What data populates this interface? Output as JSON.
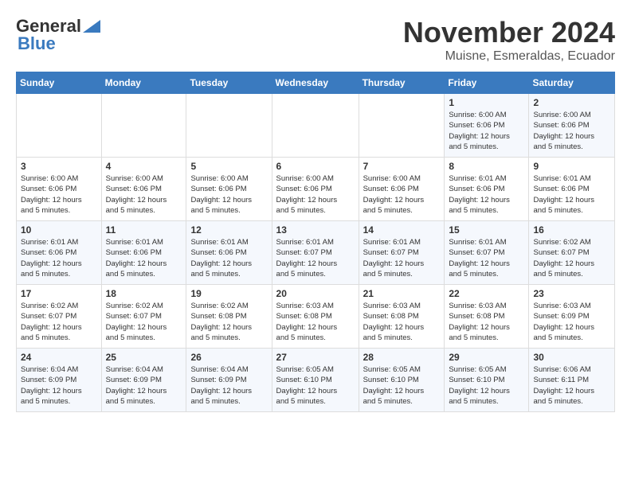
{
  "header": {
    "logo_general": "General",
    "logo_blue": "Blue",
    "title": "November 2024",
    "subtitle": "Muisne, Esmeraldas, Ecuador"
  },
  "days_of_week": [
    "Sunday",
    "Monday",
    "Tuesday",
    "Wednesday",
    "Thursday",
    "Friday",
    "Saturday"
  ],
  "weeks": [
    [
      {
        "day": "",
        "info": ""
      },
      {
        "day": "",
        "info": ""
      },
      {
        "day": "",
        "info": ""
      },
      {
        "day": "",
        "info": ""
      },
      {
        "day": "",
        "info": ""
      },
      {
        "day": "1",
        "info": "Sunrise: 6:00 AM\nSunset: 6:06 PM\nDaylight: 12 hours\nand 5 minutes."
      },
      {
        "day": "2",
        "info": "Sunrise: 6:00 AM\nSunset: 6:06 PM\nDaylight: 12 hours\nand 5 minutes."
      }
    ],
    [
      {
        "day": "3",
        "info": "Sunrise: 6:00 AM\nSunset: 6:06 PM\nDaylight: 12 hours\nand 5 minutes."
      },
      {
        "day": "4",
        "info": "Sunrise: 6:00 AM\nSunset: 6:06 PM\nDaylight: 12 hours\nand 5 minutes."
      },
      {
        "day": "5",
        "info": "Sunrise: 6:00 AM\nSunset: 6:06 PM\nDaylight: 12 hours\nand 5 minutes."
      },
      {
        "day": "6",
        "info": "Sunrise: 6:00 AM\nSunset: 6:06 PM\nDaylight: 12 hours\nand 5 minutes."
      },
      {
        "day": "7",
        "info": "Sunrise: 6:00 AM\nSunset: 6:06 PM\nDaylight: 12 hours\nand 5 minutes."
      },
      {
        "day": "8",
        "info": "Sunrise: 6:01 AM\nSunset: 6:06 PM\nDaylight: 12 hours\nand 5 minutes."
      },
      {
        "day": "9",
        "info": "Sunrise: 6:01 AM\nSunset: 6:06 PM\nDaylight: 12 hours\nand 5 minutes."
      }
    ],
    [
      {
        "day": "10",
        "info": "Sunrise: 6:01 AM\nSunset: 6:06 PM\nDaylight: 12 hours\nand 5 minutes."
      },
      {
        "day": "11",
        "info": "Sunrise: 6:01 AM\nSunset: 6:06 PM\nDaylight: 12 hours\nand 5 minutes."
      },
      {
        "day": "12",
        "info": "Sunrise: 6:01 AM\nSunset: 6:06 PM\nDaylight: 12 hours\nand 5 minutes."
      },
      {
        "day": "13",
        "info": "Sunrise: 6:01 AM\nSunset: 6:07 PM\nDaylight: 12 hours\nand 5 minutes."
      },
      {
        "day": "14",
        "info": "Sunrise: 6:01 AM\nSunset: 6:07 PM\nDaylight: 12 hours\nand 5 minutes."
      },
      {
        "day": "15",
        "info": "Sunrise: 6:01 AM\nSunset: 6:07 PM\nDaylight: 12 hours\nand 5 minutes."
      },
      {
        "day": "16",
        "info": "Sunrise: 6:02 AM\nSunset: 6:07 PM\nDaylight: 12 hours\nand 5 minutes."
      }
    ],
    [
      {
        "day": "17",
        "info": "Sunrise: 6:02 AM\nSunset: 6:07 PM\nDaylight: 12 hours\nand 5 minutes."
      },
      {
        "day": "18",
        "info": "Sunrise: 6:02 AM\nSunset: 6:07 PM\nDaylight: 12 hours\nand 5 minutes."
      },
      {
        "day": "19",
        "info": "Sunrise: 6:02 AM\nSunset: 6:08 PM\nDaylight: 12 hours\nand 5 minutes."
      },
      {
        "day": "20",
        "info": "Sunrise: 6:03 AM\nSunset: 6:08 PM\nDaylight: 12 hours\nand 5 minutes."
      },
      {
        "day": "21",
        "info": "Sunrise: 6:03 AM\nSunset: 6:08 PM\nDaylight: 12 hours\nand 5 minutes."
      },
      {
        "day": "22",
        "info": "Sunrise: 6:03 AM\nSunset: 6:08 PM\nDaylight: 12 hours\nand 5 minutes."
      },
      {
        "day": "23",
        "info": "Sunrise: 6:03 AM\nSunset: 6:09 PM\nDaylight: 12 hours\nand 5 minutes."
      }
    ],
    [
      {
        "day": "24",
        "info": "Sunrise: 6:04 AM\nSunset: 6:09 PM\nDaylight: 12 hours\nand 5 minutes."
      },
      {
        "day": "25",
        "info": "Sunrise: 6:04 AM\nSunset: 6:09 PM\nDaylight: 12 hours\nand 5 minutes."
      },
      {
        "day": "26",
        "info": "Sunrise: 6:04 AM\nSunset: 6:09 PM\nDaylight: 12 hours\nand 5 minutes."
      },
      {
        "day": "27",
        "info": "Sunrise: 6:05 AM\nSunset: 6:10 PM\nDaylight: 12 hours\nand 5 minutes."
      },
      {
        "day": "28",
        "info": "Sunrise: 6:05 AM\nSunset: 6:10 PM\nDaylight: 12 hours\nand 5 minutes."
      },
      {
        "day": "29",
        "info": "Sunrise: 6:05 AM\nSunset: 6:10 PM\nDaylight: 12 hours\nand 5 minutes."
      },
      {
        "day": "30",
        "info": "Sunrise: 6:06 AM\nSunset: 6:11 PM\nDaylight: 12 hours\nand 5 minutes."
      }
    ]
  ]
}
